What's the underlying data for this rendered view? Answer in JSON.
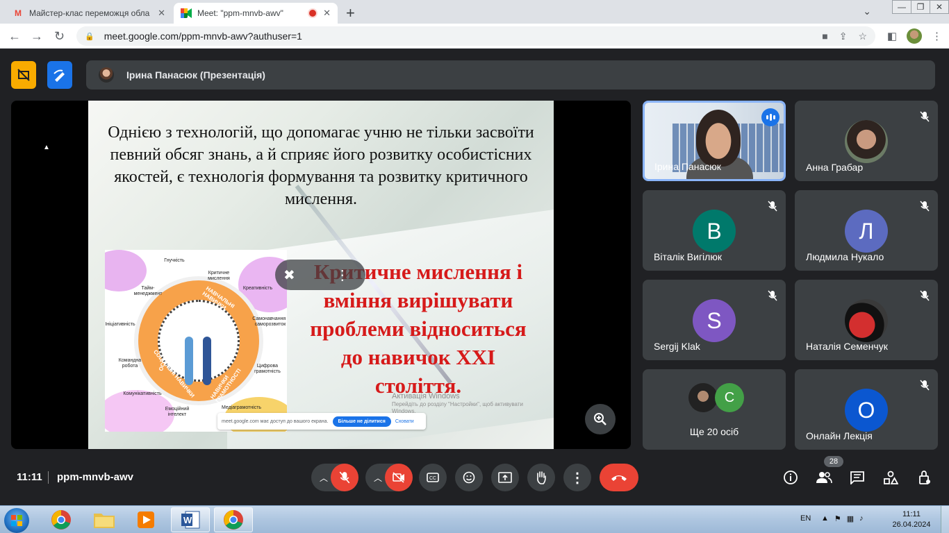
{
  "browser": {
    "tabs": [
      {
        "title": "Майстер-клас переможця обла",
        "icon": "gmail-icon"
      },
      {
        "title": "Meet: \"ppm-mnvb-awv\"",
        "icon": "meet-icon",
        "recording": true
      }
    ],
    "url": "meet.google.com/ppm-mnvb-awv?authuser=1"
  },
  "presenter_bar": {
    "label": "Ірина Панасюк (Презентація)"
  },
  "slide": {
    "main_text": "Однією з технологій, що допомагає учню не тільки засвоїти певний обсяг знань, а й сприяє його розвитку особистісних якостей, є технологія формування та розвитку критичного мислення.",
    "red_text": "Критичне мислення і вміння вирішувати проблеми відноситься до навичок XXI століття.",
    "infographic": {
      "labels": [
        "Гнучкість",
        "Критичне мислення",
        "Креативність",
        "Тайм-менеджмент",
        "Самонавчання і саморозвиток",
        "Ініціативність",
        "Командна робота",
        "Цифрова грамотність",
        "Комунікативність",
        "Медіаграмотність",
        "Емоційний інтелект"
      ],
      "wheel": [
        "ОСОБИСТІСНІ НАВИЧКИ",
        "НАВЧАЛЬНІ НАВИЧКИ",
        "СОЦІАЛЬНІ НАВИЧКИ",
        "НАВИЧКИ ГРАМОТНОСТІ"
      ]
    },
    "share_notice": {
      "text": "meet.google.com має доступ до вашого екрана.",
      "stop_label": "Більше не ділитися",
      "hide_label": "Сховати"
    }
  },
  "activation": {
    "title": "Активація Windows",
    "sub": "Перейдіть до розділу \"Настройки\", щоб активувати Windows."
  },
  "participants": [
    {
      "name": "Ірина Панасюк",
      "speaking": true,
      "type": "video"
    },
    {
      "name": "Анна Грабар",
      "muted": true,
      "type": "photo"
    },
    {
      "name": "Віталік Вигілюк",
      "muted": true,
      "initial": "В",
      "color": "#00796b"
    },
    {
      "name": "Людмила Нукало",
      "muted": true,
      "initial": "Л",
      "color": "#5c6bc0"
    },
    {
      "name": "Sergij Klak",
      "muted": true,
      "initial": "S",
      "color": "#7e57c2"
    },
    {
      "name": "Наталія Семенчук",
      "muted": true,
      "type": "photo"
    },
    {
      "name": "Ще 20 осіб",
      "type": "more",
      "initial": "C",
      "color": "#43a047"
    },
    {
      "name": "Онлайн Лекція",
      "muted": true,
      "initial": "О",
      "color": "#0b57d0"
    }
  ],
  "bottombar": {
    "time": "11:11",
    "meeting_code": "ppm-mnvb-awv",
    "people_count": "28"
  },
  "taskbar": {
    "lang": "EN",
    "time": "11:11",
    "date": "26.04.2024"
  }
}
